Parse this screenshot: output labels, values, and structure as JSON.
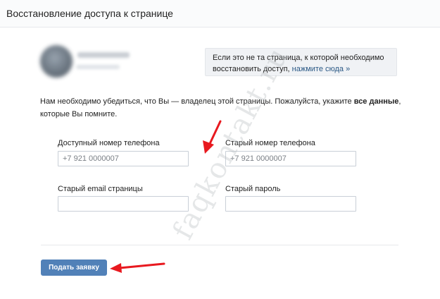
{
  "header": {
    "title": "Восстановление доступа к странице"
  },
  "info_box": {
    "line1": "Если это не та страница, к которой необходимо",
    "line2_prefix": "восстановить доступ,",
    "link": "нажмите сюда »"
  },
  "description": {
    "text_before": "Нам необходимо убедиться, что Вы — владелец этой страницы. Пожалуйста, укажите",
    "bold": "все данные",
    "text_after": ", которые Вы помните."
  },
  "form": {
    "phone_available": {
      "label": "Доступный номер телефона",
      "placeholder": "+7 921 0000007",
      "value": ""
    },
    "phone_old": {
      "label": "Старый номер телефона",
      "placeholder": "+7 921 0000007",
      "value": ""
    },
    "email_old": {
      "label": "Старый email страницы",
      "placeholder": "",
      "value": ""
    },
    "password_old": {
      "label": "Старый пароль",
      "placeholder": "",
      "value": ""
    }
  },
  "submit_label": "Подать заявку",
  "watermark": "faqkontakt.ru",
  "colors": {
    "accent": "#5181b8",
    "link": "#2a5885",
    "annotation_arrow": "#e8191f"
  }
}
